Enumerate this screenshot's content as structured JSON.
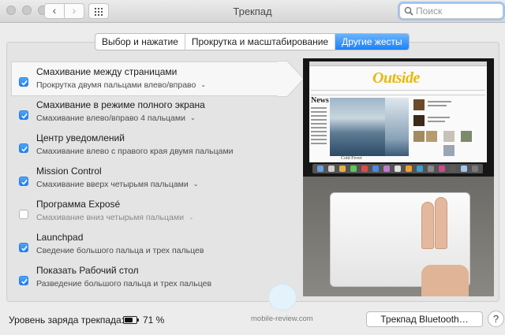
{
  "window": {
    "title": "Трекпад"
  },
  "search": {
    "placeholder": "Поиск"
  },
  "tabs": [
    {
      "label": "Выбор и нажатие",
      "active": false
    },
    {
      "label": "Прокрутка и масштабирование",
      "active": false
    },
    {
      "label": "Другие жесты",
      "active": true
    }
  ],
  "gestures": [
    {
      "title": "Смахивание между страницами",
      "subtitle": "Прокрутка двумя пальцами влево/вправо",
      "checked": true,
      "has_menu": true
    },
    {
      "title": "Смахивание в режиме полного экрана",
      "subtitle": "Смахивание влево/вправо 4 пальцами",
      "checked": true,
      "has_menu": true
    },
    {
      "title": "Центр уведомлений",
      "subtitle": "Смахивание влево с правого края двумя пальцами",
      "checked": true,
      "has_menu": false
    },
    {
      "title": "Mission Control",
      "subtitle": "Смахивание вверх четырьмя пальцами",
      "checked": true,
      "has_menu": true
    },
    {
      "title": "Программа Exposé",
      "subtitle": "Смахивание вниз четырьмя пальцами",
      "checked": false,
      "has_menu": true
    },
    {
      "title": "Launchpad",
      "subtitle": "Сведение большого пальца и трех пальцев",
      "checked": true,
      "has_menu": false
    },
    {
      "title": "Показать Рабочий стол",
      "subtitle": "Разведение большого пальца и трех пальцев",
      "checked": true,
      "has_menu": false
    }
  ],
  "preview": {
    "logo": "Outside",
    "news": "News",
    "caption": "Cold Fever"
  },
  "footer": {
    "battery_label": "Уровень заряда трекпада:",
    "battery_percent": "71 %",
    "battery_level": 0.71,
    "bluetooth_button": "Трекпад Bluetooth…",
    "help": "?"
  },
  "watermark": "mobile-review.com",
  "colors": {
    "accent": "#1a82fb",
    "checkbox": "#2f86f7"
  }
}
